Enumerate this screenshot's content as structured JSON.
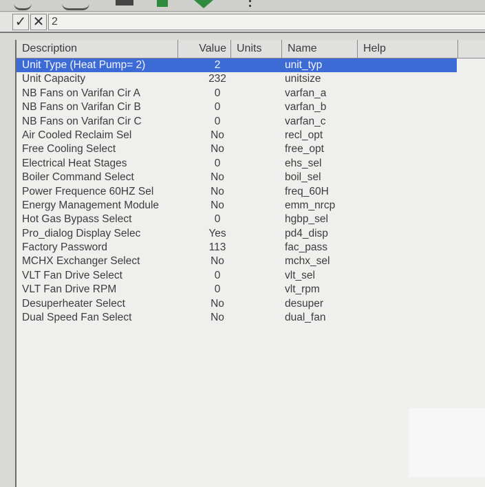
{
  "edit_bar": {
    "accept_icon": "✓",
    "cancel_icon": "✕",
    "value": "2"
  },
  "columns": [
    "Description",
    "Value",
    "Units",
    "Name",
    "Help"
  ],
  "rows": [
    {
      "description": "Unit Type (Heat Pump= 2)",
      "value": "2",
      "units": "",
      "name": "unit_typ",
      "selected": true
    },
    {
      "description": "Unit Capacity",
      "value": "232",
      "units": "",
      "name": "unitsize"
    },
    {
      "description": "NB Fans on Varifan Cir A",
      "value": "0",
      "units": "",
      "name": "varfan_a"
    },
    {
      "description": "NB Fans on Varifan Cir B",
      "value": "0",
      "units": "",
      "name": "varfan_b"
    },
    {
      "description": "NB Fans on Varifan Cir C",
      "value": "0",
      "units": "",
      "name": "varfan_c"
    },
    {
      "description": "Air Cooled Reclaim Sel",
      "value": "No",
      "units": "",
      "name": "recl_opt"
    },
    {
      "description": "Free Cooling Select",
      "value": "No",
      "units": "",
      "name": "free_opt"
    },
    {
      "description": "Electrical Heat Stages",
      "value": "0",
      "units": "",
      "name": "ehs_sel"
    },
    {
      "description": "Boiler Command Select",
      "value": "No",
      "units": "",
      "name": "boil_sel"
    },
    {
      "description": "Power Frequence 60HZ Sel",
      "value": "No",
      "units": "",
      "name": "freq_60H"
    },
    {
      "description": "Energy Management Module",
      "value": "No",
      "units": "",
      "name": "emm_nrcp"
    },
    {
      "description": "Hot Gas Bypass Select",
      "value": "0",
      "units": "",
      "name": "hgbp_sel"
    },
    {
      "description": "Pro_dialog Display Selec",
      "value": "Yes",
      "units": "",
      "name": "pd4_disp"
    },
    {
      "description": "Factory Password",
      "value": "113",
      "units": "",
      "name": "fac_pass"
    },
    {
      "description": "MCHX Exchanger Select",
      "value": "No",
      "units": "",
      "name": "mchx_sel"
    },
    {
      "description": "VLT Fan Drive Select",
      "value": "0",
      "units": "",
      "name": "vlt_sel"
    },
    {
      "description": "VLT Fan Drive RPM",
      "value": "0",
      "units": "",
      "name": "vlt_rpm"
    },
    {
      "description": "Desuperheater Select",
      "value": "No",
      "units": "",
      "name": "desuper"
    },
    {
      "description": "Dual Speed Fan Select",
      "value": "No",
      "units": "",
      "name": "dual_fan"
    }
  ],
  "colors": {
    "selection": "#3d6bd6",
    "grid_bg": "#efefed"
  }
}
